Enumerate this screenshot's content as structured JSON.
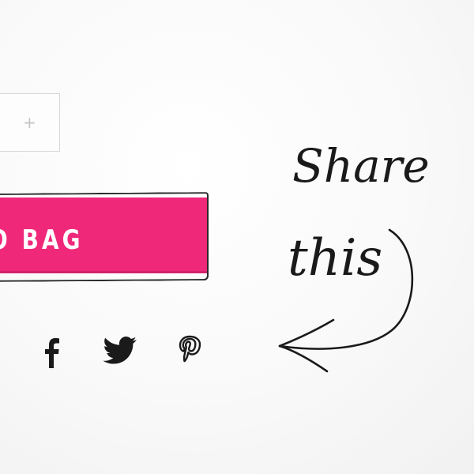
{
  "quantity": {
    "increment_symbol": "+",
    "increment_icon": "plus-icon"
  },
  "cart": {
    "add_label": "O BAG",
    "button_color": "#f0287a"
  },
  "share": {
    "annotation_line1": "Share",
    "annotation_line2": "this",
    "arrow_icon": "curved-arrow-icon",
    "networks": [
      {
        "name": "facebook",
        "icon": "facebook-icon"
      },
      {
        "name": "twitter",
        "icon": "twitter-icon"
      },
      {
        "name": "pinterest",
        "icon": "pinterest-icon"
      }
    ]
  }
}
